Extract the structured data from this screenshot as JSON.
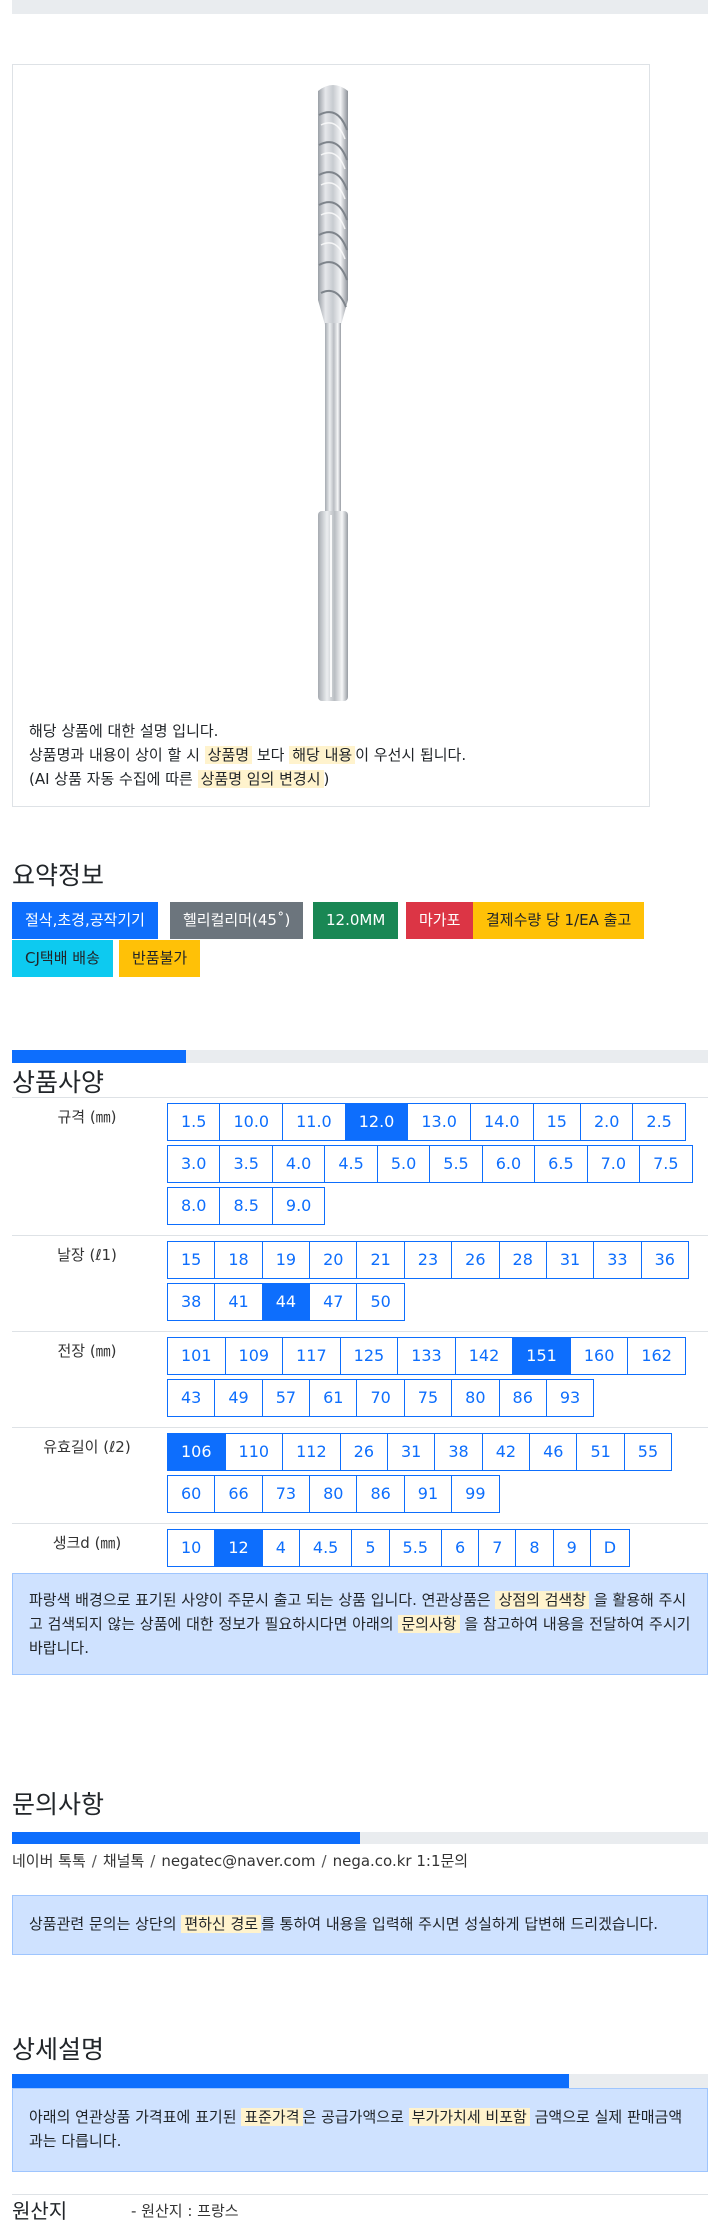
{
  "product": {
    "desc_line1": "해당 상품에 대한 설명 입니다.",
    "desc_line2_a": "상품명과 내용이 상이 할 시",
    "desc_line2_hl1": "상품명",
    "desc_line2_b": "보다",
    "desc_line2_hl2": "해당 내용",
    "desc_line2_c": "이 우선시 됩니다.",
    "desc_line3_a": "(AI 상품 자동 수집에 따른",
    "desc_line3_hl": "상품명 임의 변경시",
    "desc_line3_b": ")"
  },
  "summary": {
    "title": "요약정보",
    "badges": [
      {
        "label": "절삭,초경,공작기기",
        "bg": "#0d6efd",
        "fg": "#ffffff"
      },
      {
        "label": "헬리컬리머(45˚)",
        "bg": "#6c757d",
        "fg": "#ffffff"
      },
      {
        "label": "12.0MM",
        "bg": "#198754",
        "fg": "#ffffff"
      },
      {
        "label": "마가포",
        "bg": "#dc3545",
        "fg": "#ffffff"
      },
      {
        "label": "결제수량 당 1/EA 출고",
        "bg": "#ffc107",
        "fg": "#212529"
      },
      {
        "label": "CJ택배 배송",
        "bg": "#0dcaf0",
        "fg": "#212529"
      },
      {
        "label": "반품불가",
        "bg": "#ffc107",
        "fg": "#212529"
      }
    ]
  },
  "spec": {
    "title": "상품사양",
    "progress": 0.25,
    "rows": [
      {
        "label": "규격 (㎜)",
        "selected": "12.0",
        "options": [
          "1.5",
          "10.0",
          "11.0",
          "12.0",
          "13.0",
          "14.0",
          "15",
          "2.0",
          "2.5",
          "3.0",
          "3.5",
          "4.0",
          "4.5",
          "5.0",
          "5.5",
          "6.0",
          "6.5",
          "7.0",
          "7.5",
          "8.0",
          "8.5",
          "9.0"
        ]
      },
      {
        "label": "날장 (ℓ1)",
        "selected": "44",
        "options": [
          "15",
          "18",
          "19",
          "20",
          "21",
          "23",
          "26",
          "28",
          "31",
          "33",
          "36",
          "38",
          "41",
          "44",
          "47",
          "50"
        ]
      },
      {
        "label": "전장 (㎜)",
        "selected": "151",
        "options": [
          "101",
          "109",
          "117",
          "125",
          "133",
          "142",
          "151",
          "160",
          "162",
          "43",
          "49",
          "57",
          "61",
          "70",
          "75",
          "80",
          "86",
          "93"
        ]
      },
      {
        "label": "유효길이 (ℓ2)",
        "selected": "106",
        "options": [
          "106",
          "110",
          "112",
          "26",
          "31",
          "38",
          "42",
          "46",
          "51",
          "55",
          "60",
          "66",
          "73",
          "80",
          "86",
          "91",
          "99"
        ]
      },
      {
        "label": "생크d (㎜)",
        "selected": "12",
        "options": [
          "10",
          "12",
          "4",
          "4.5",
          "5",
          "5.5",
          "6",
          "7",
          "8",
          "9",
          "D"
        ]
      }
    ],
    "notice_a": "파랑색 배경으로 표기된 사양이 주문시 출고 되는 상품 입니다. 연관상품은",
    "notice_hl1": "상점의 검색창",
    "notice_b": "을 활용해 주시고 검색되지 않는 상품에 대한 정보가 필요하시다면 아래의",
    "notice_hl2": "문의사항",
    "notice_c": "을 참고하여 내용을 전달하여 주시기 바랍니다."
  },
  "inquiry": {
    "title": "문의사항",
    "progress": 0.5,
    "contacts": [
      "네이버 톡톡",
      "채널톡",
      "negatec@naver.com",
      "nega.co.kr 1:1문의"
    ],
    "separator": "/",
    "notice_a": "상품관련 문의는 상단의",
    "notice_hl": "편하신 경로",
    "notice_b": "를 통하여 내용을 입력해 주시면 성실하게 답변해 드리겠습니다."
  },
  "detail": {
    "title": "상세설명",
    "progress": 0.8,
    "notice_a": "아래의 연관상품 가격표에 표기된",
    "notice_hl1": "표준가격",
    "notice_b": "은 공급가액으로",
    "notice_hl2": "부가가치세 비포함",
    "notice_c": "금액으로 실제 판매금액과는 다릅니다."
  },
  "origin": {
    "label": "원산지",
    "value": "- 원산지 : 프랑스"
  },
  "colors": {
    "primary": "#0d6efd",
    "alert_bg": "#cfe2ff",
    "highlight": "#fff3cd"
  }
}
